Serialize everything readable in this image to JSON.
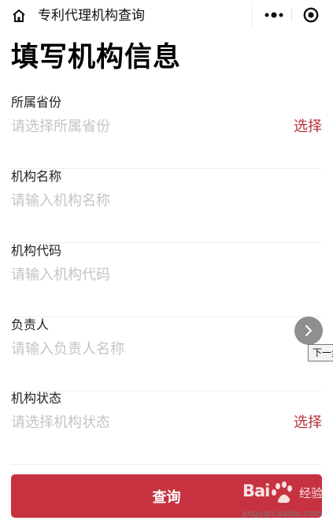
{
  "topbar": {
    "title": "专利代理机构查询"
  },
  "page": {
    "title": "填写机构信息"
  },
  "fields": [
    {
      "label": "所属省份",
      "placeholder": "请选择所属省份",
      "action": "选择"
    },
    {
      "label": "机构名称",
      "placeholder": "请输入机构名称"
    },
    {
      "label": "机构代码",
      "placeholder": "请输入机构代码"
    },
    {
      "label": "负责人",
      "placeholder": "请输入负责人名称"
    },
    {
      "label": "机构状态",
      "placeholder": "请选择机构状态",
      "action": "选择"
    }
  ],
  "submit": {
    "label": "查询"
  },
  "overlay": {
    "tooltip": "下一步"
  },
  "watermark": {
    "logo": "Bai",
    "brand": "经验",
    "url": "jingyan.baidu.com"
  },
  "colors": {
    "accent": "#c6323f",
    "select_text": "#b5303d",
    "placeholder": "#c4c4c4"
  }
}
